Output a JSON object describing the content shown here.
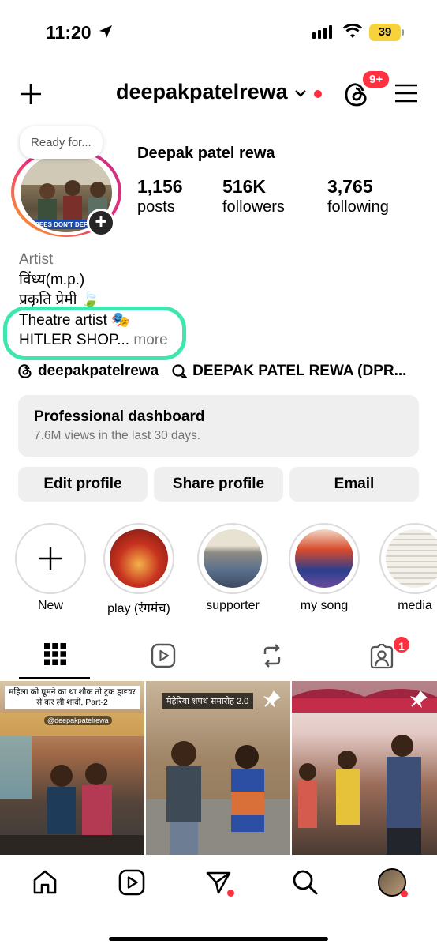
{
  "status_bar": {
    "time": "11:20",
    "battery": "39"
  },
  "header": {
    "username": "deepakpatelrewa",
    "threads_badge": "9+"
  },
  "profile": {
    "ready_note": "Ready for...",
    "display_name": "Deepak patel rewa",
    "stats": [
      {
        "value": "1,156",
        "label": "posts"
      },
      {
        "value": "516K",
        "label": "followers"
      },
      {
        "value": "3,765",
        "label": "following"
      }
    ],
    "bio": {
      "category": "Artist",
      "line1": "विंध्य(m.p.)",
      "line2": "प्रकृति प्रेमी 🍃",
      "line3": "Theatre artist 🎭",
      "line4": "HITLER SHOP...",
      "more": "more"
    },
    "links": {
      "threads": "deepakpatelrewa",
      "community": "DEEPAK PATEL REWA (DPR..."
    }
  },
  "dashboard": {
    "title": "Professional dashboard",
    "subtitle": "7.6M views in the last 30 days."
  },
  "buttons": {
    "edit": "Edit profile",
    "share": "Share profile",
    "email": "Email"
  },
  "highlights": [
    {
      "label": "New"
    },
    {
      "label": "play (रंगमंच)"
    },
    {
      "label": "supporter"
    },
    {
      "label": "my song"
    },
    {
      "label": "media"
    }
  ],
  "tabs": {
    "tagged_badge": "1"
  },
  "posts": [
    {
      "caption": "महिला को घूमने का था शौक तो ट्रक ड्राइवर से कर ली शादी, Part-2",
      "handle": "@deepakpatelrewa"
    },
    {
      "caption": "मेहेरिया शपथ समारोह 2.0"
    },
    {
      "caption": ""
    }
  ],
  "colors": {
    "accent_red": "#ff3040",
    "highlight_green": "#3ee6b0",
    "button_gray": "#efefef"
  }
}
